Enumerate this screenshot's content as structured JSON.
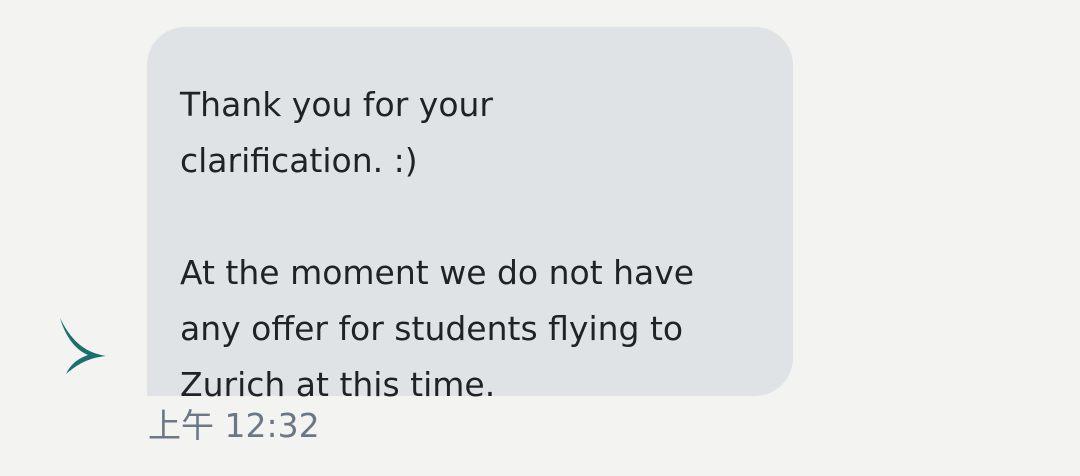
{
  "message": {
    "sender_icon": "cathay-pacific-brushwing-logo",
    "sender_icon_color": "#1b6f6f",
    "bubble_color": "#dfe3e6",
    "paragraph_1": [
      "Thank you for your",
      "clarification. :)"
    ],
    "paragraph_2": [
      "At the moment we do not have",
      "any offer for students flying to",
      "Zurich at this time."
    ],
    "timestamp": "上午 12:32"
  }
}
